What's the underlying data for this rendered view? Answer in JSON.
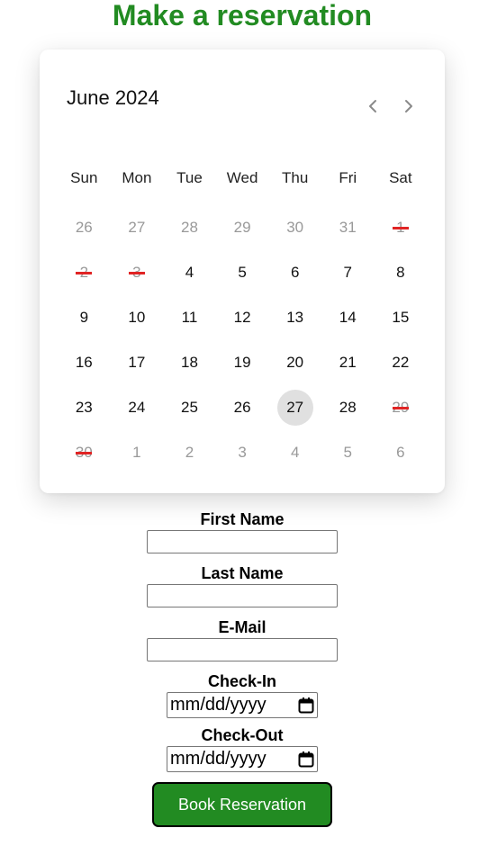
{
  "header": {
    "title": "Make a reservation"
  },
  "calendar": {
    "month_label": "June 2024",
    "weekdays": [
      "Sun",
      "Mon",
      "Tue",
      "Wed",
      "Thu",
      "Fri",
      "Sat"
    ],
    "days": [
      {
        "label": "26",
        "state": "other"
      },
      {
        "label": "27",
        "state": "other"
      },
      {
        "label": "28",
        "state": "other"
      },
      {
        "label": "29",
        "state": "other"
      },
      {
        "label": "30",
        "state": "other"
      },
      {
        "label": "31",
        "state": "other"
      },
      {
        "label": "1",
        "state": "blocked"
      },
      {
        "label": "2",
        "state": "blocked"
      },
      {
        "label": "3",
        "state": "blocked"
      },
      {
        "label": "4",
        "state": "normal"
      },
      {
        "label": "5",
        "state": "normal"
      },
      {
        "label": "6",
        "state": "normal"
      },
      {
        "label": "7",
        "state": "normal"
      },
      {
        "label": "8",
        "state": "normal"
      },
      {
        "label": "9",
        "state": "normal"
      },
      {
        "label": "10",
        "state": "normal"
      },
      {
        "label": "11",
        "state": "normal"
      },
      {
        "label": "12",
        "state": "normal"
      },
      {
        "label": "13",
        "state": "normal"
      },
      {
        "label": "14",
        "state": "normal"
      },
      {
        "label": "15",
        "state": "normal"
      },
      {
        "label": "16",
        "state": "normal"
      },
      {
        "label": "17",
        "state": "normal"
      },
      {
        "label": "18",
        "state": "normal"
      },
      {
        "label": "19",
        "state": "normal"
      },
      {
        "label": "20",
        "state": "normal"
      },
      {
        "label": "21",
        "state": "normal"
      },
      {
        "label": "22",
        "state": "normal"
      },
      {
        "label": "23",
        "state": "normal"
      },
      {
        "label": "24",
        "state": "normal"
      },
      {
        "label": "25",
        "state": "normal"
      },
      {
        "label": "26",
        "state": "normal"
      },
      {
        "label": "27",
        "state": "today"
      },
      {
        "label": "28",
        "state": "normal"
      },
      {
        "label": "29",
        "state": "blocked"
      },
      {
        "label": "30",
        "state": "blocked"
      },
      {
        "label": "1",
        "state": "other"
      },
      {
        "label": "2",
        "state": "other"
      },
      {
        "label": "3",
        "state": "other"
      },
      {
        "label": "4",
        "state": "other"
      },
      {
        "label": "5",
        "state": "other"
      },
      {
        "label": "6",
        "state": "other"
      }
    ],
    "prev_icon": "chevron-left-icon",
    "next_icon": "chevron-right-icon"
  },
  "form": {
    "first_name": {
      "label": "First Name",
      "value": ""
    },
    "last_name": {
      "label": "Last Name",
      "value": ""
    },
    "email": {
      "label": "E-Mail",
      "value": ""
    },
    "check_in": {
      "label": "Check-In",
      "placeholder": "mm/dd/yyyy"
    },
    "check_out": {
      "label": "Check-Out",
      "placeholder": "mm/dd/yyyy"
    },
    "submit_label": "Book Reservation"
  },
  "colors": {
    "accent": "#228b22",
    "blocked_strike": "#e02424",
    "today_bg": "#e0e0e0"
  }
}
